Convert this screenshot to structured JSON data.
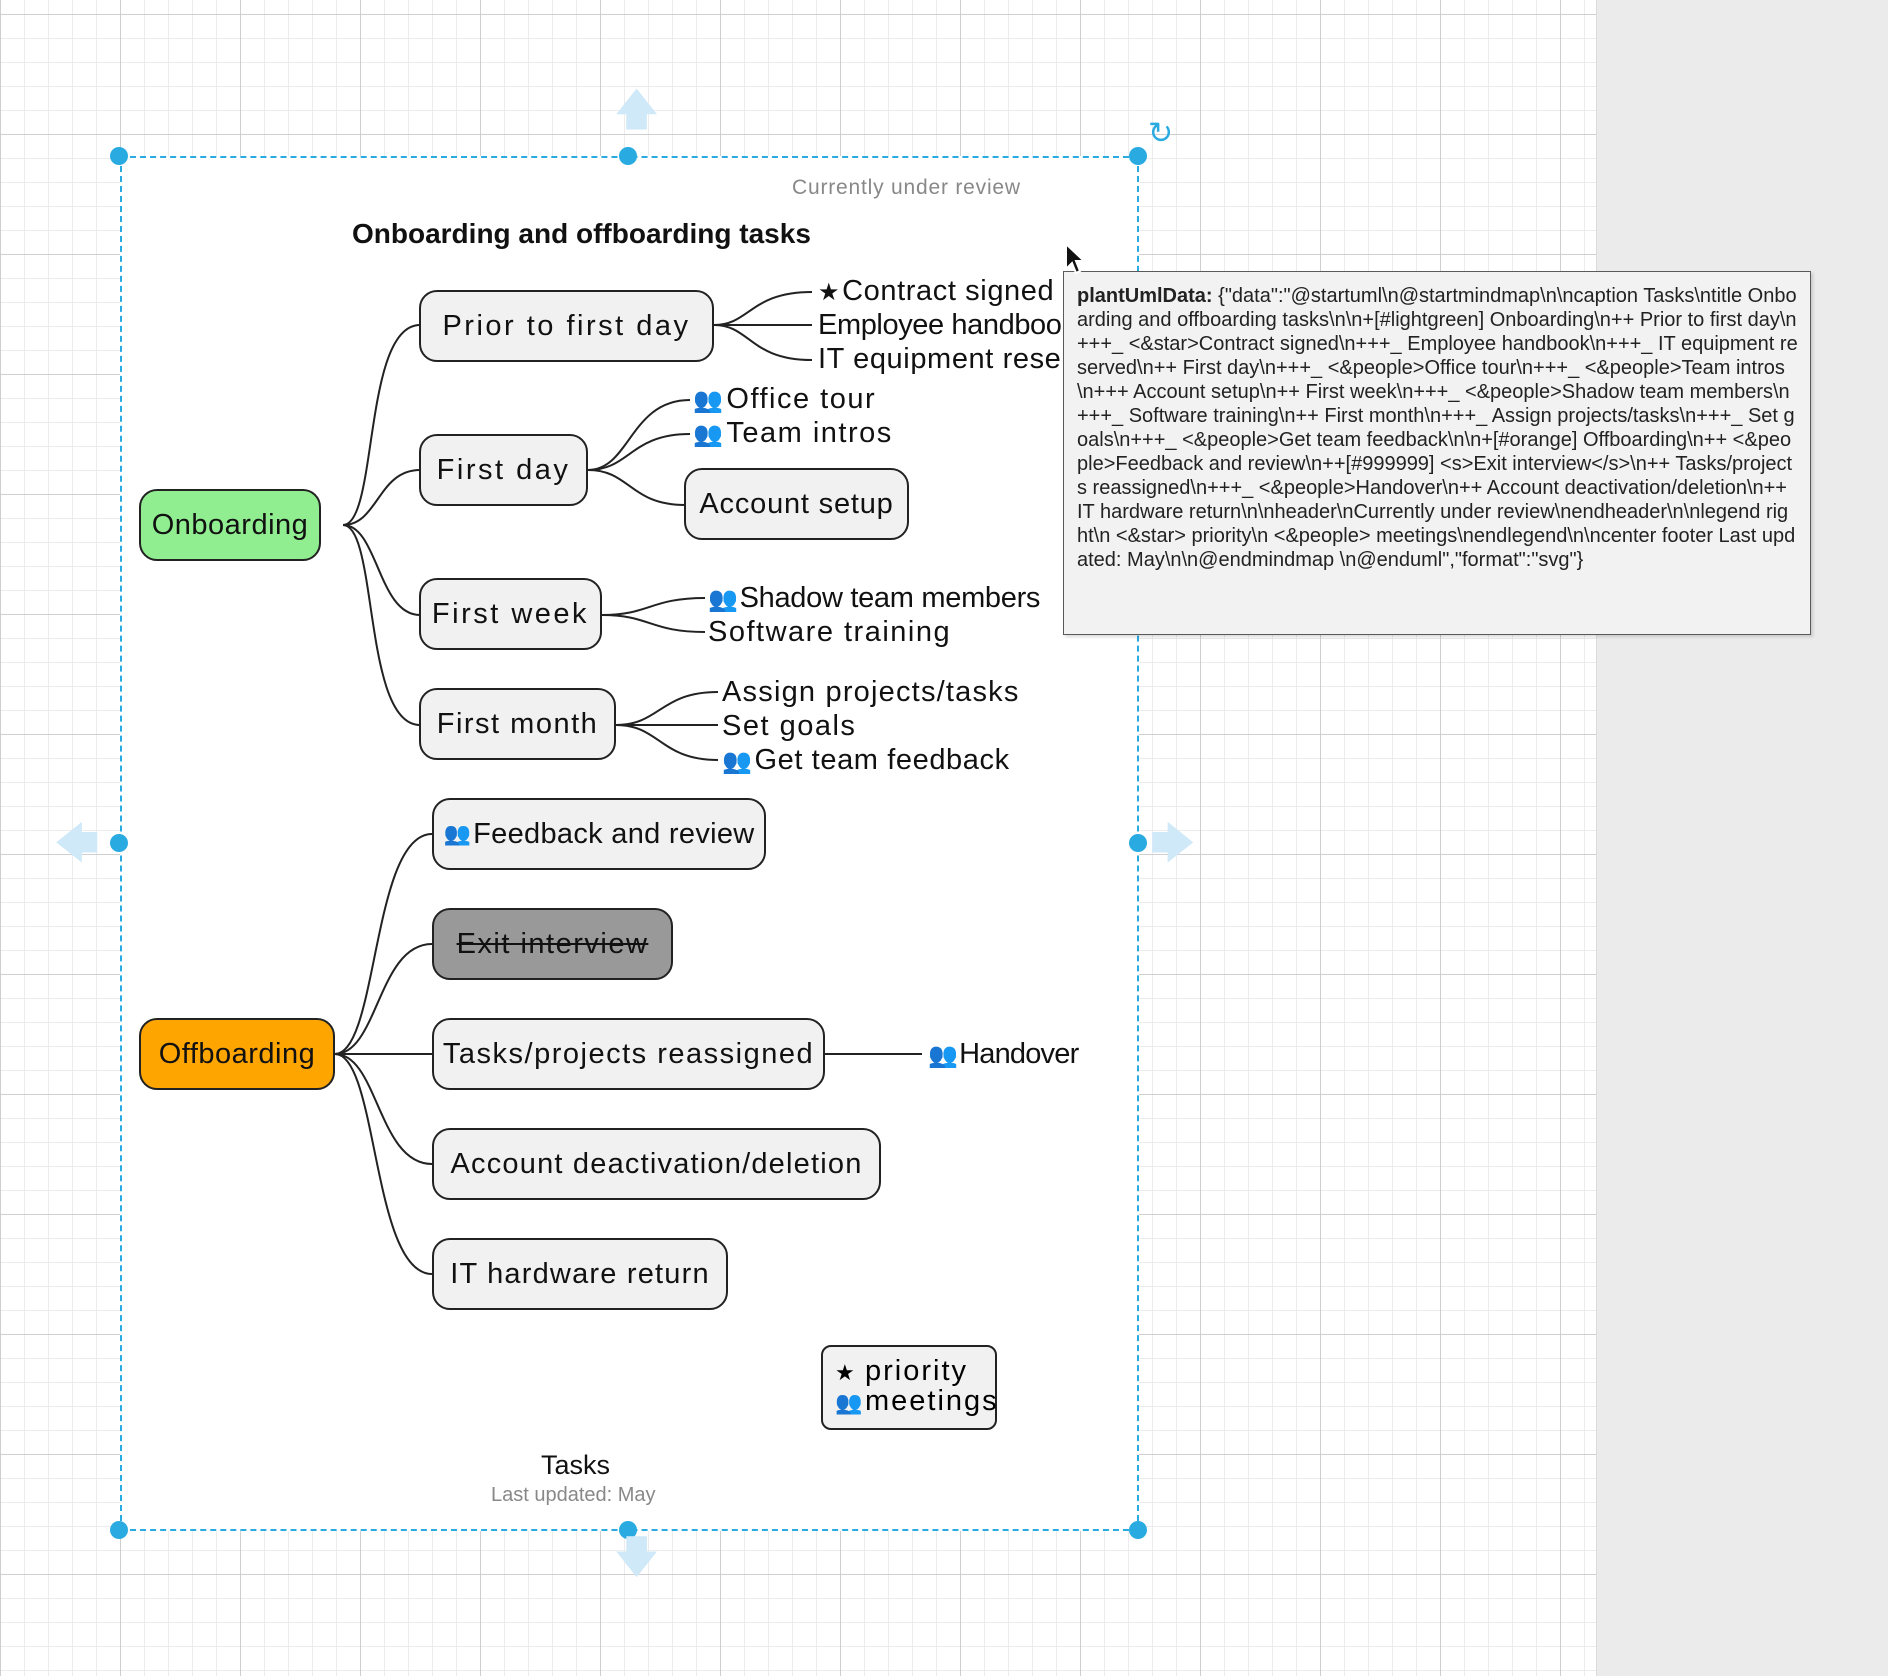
{
  "diagram": {
    "header": "Currently under review",
    "title": "Onboarding and offboarding tasks",
    "caption": "Tasks",
    "footer": "Last updated: May",
    "colors": {
      "onboarding": "#90ee90",
      "offboarding": "#ffa500",
      "strikethrough_node": "#999999",
      "node_fill": "#f1f1f1",
      "selection": "#29abe2"
    },
    "onboarding": {
      "label": "Onboarding",
      "prior_to_first_day": {
        "label": "Prior to first day",
        "contract_signed": "Contract signed",
        "employee_handbook": "Employee handbook",
        "it_equipment_reserved": "IT equipment reser"
      },
      "first_day": {
        "label": "First day",
        "office_tour": "Office tour",
        "team_intros": "Team intros",
        "account_setup": "Account setup"
      },
      "first_week": {
        "label": "First week",
        "shadow_team_members": "Shadow team members",
        "software_training": "Software training"
      },
      "first_month": {
        "label": "First month",
        "assign_projects": "Assign projects/tasks",
        "set_goals": "Set goals",
        "get_team_feedback": "Get team feedback"
      }
    },
    "offboarding": {
      "label": "Offboarding",
      "feedback_and_review": "Feedback and review",
      "exit_interview": "Exit interview",
      "tasks_reassigned": "Tasks/projects reassigned",
      "handover": "Handover",
      "account_deactivation": "Account deactivation/deletion",
      "it_hardware_return": "IT hardware return"
    },
    "legend": {
      "priority": "priority",
      "meetings": "meetings",
      "priority_icon": "star-icon",
      "meetings_icon": "people-icon"
    }
  },
  "tooltip": {
    "key": "plantUmlData:",
    "value": " {\"data\":\"@startuml\\n@startmindmap\\n\\ncaption Tasks\\ntitle Onboarding and offboarding tasks\\n\\n+[#lightgreen] Onboarding\\n++ Prior to first day\\n+++_ <&star>Contract signed\\n+++_ Employee handbook\\n+++_ IT equipment reserved\\n++ First day\\n+++_ <&people>Office tour\\n+++_ <&people>Team intros\\n+++ Account setup\\n++ First week\\n+++_ <&people>Shadow team members\\n+++_ Software training\\n++ First month\\n+++_ Assign projects/tasks\\n+++_ Set goals\\n+++_ <&people>Get team feedback\\n\\n+[#orange] Offboarding\\n++ <&people>Feedback and review\\n++[#999999] <s>Exit interview</s>\\n++ Tasks/projects reassigned\\n+++_ <&people>Handover\\n++ Account deactivation/deletion\\n++ IT hardware return\\n\\nheader\\nCurrently under review\\nendheader\\n\\nlegend right\\n <&star> priority\\n <&people> meetings\\nendlegend\\n\\ncenter footer Last updated: May\\n\\n@endmindmap \\n@enduml\",\"format\":\"svg\"}"
  }
}
